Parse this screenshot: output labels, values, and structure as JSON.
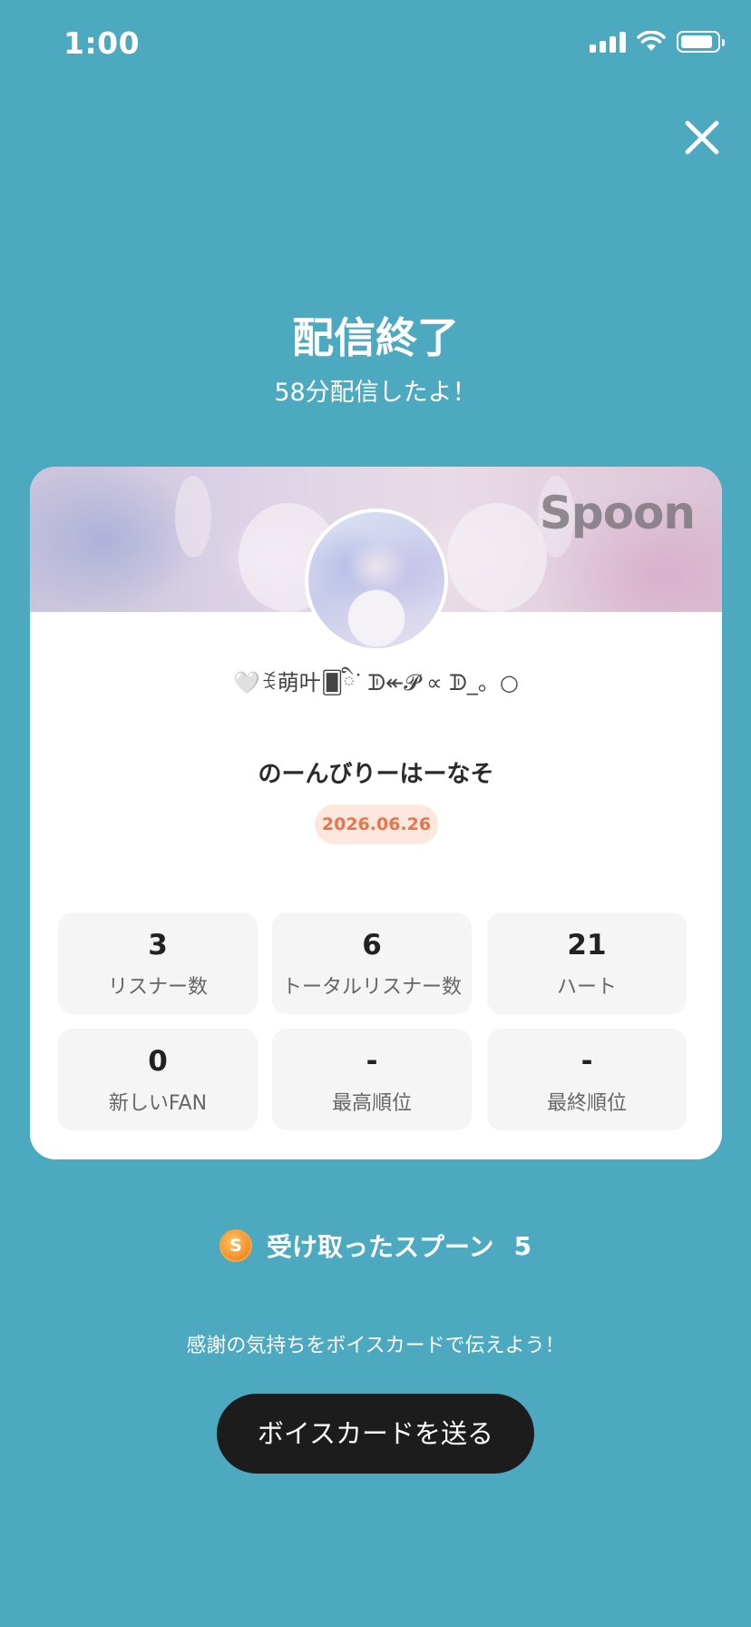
{
  "status_bar": {
    "time": "1:00"
  },
  "header": {
    "title": "配信終了",
    "subtitle": "58分配信したよ！"
  },
  "card": {
    "banner_logo": "Spoon",
    "username": "🤍ꉂ萌叶🂠ིᐝ ᗫ↞𝓟 ∝ ᗫ_。○",
    "room_title": "のーんびりーはーなそ",
    "date": "2026.06.26",
    "stats": [
      {
        "value": "3",
        "label": "リスナー数"
      },
      {
        "value": "6",
        "label": "トータルリスナー数"
      },
      {
        "value": "21",
        "label": "ハート"
      },
      {
        "value": "0",
        "label": "新しいFAN"
      },
      {
        "value": "-",
        "label": "最高順位"
      },
      {
        "value": "-",
        "label": "最終順位"
      }
    ]
  },
  "spoons": {
    "icon": "S",
    "label": "受け取ったスプーン",
    "count": "5"
  },
  "footer": {
    "message": "感謝の気持ちをボイスカードで伝えよう！",
    "button_label": "ボイスカードを送る"
  },
  "colors": {
    "background": "#4ca9bf",
    "date_badge_text": "#e8754b",
    "date_badge_bg": "#fde7df",
    "button_bg": "#1c1c1c"
  }
}
